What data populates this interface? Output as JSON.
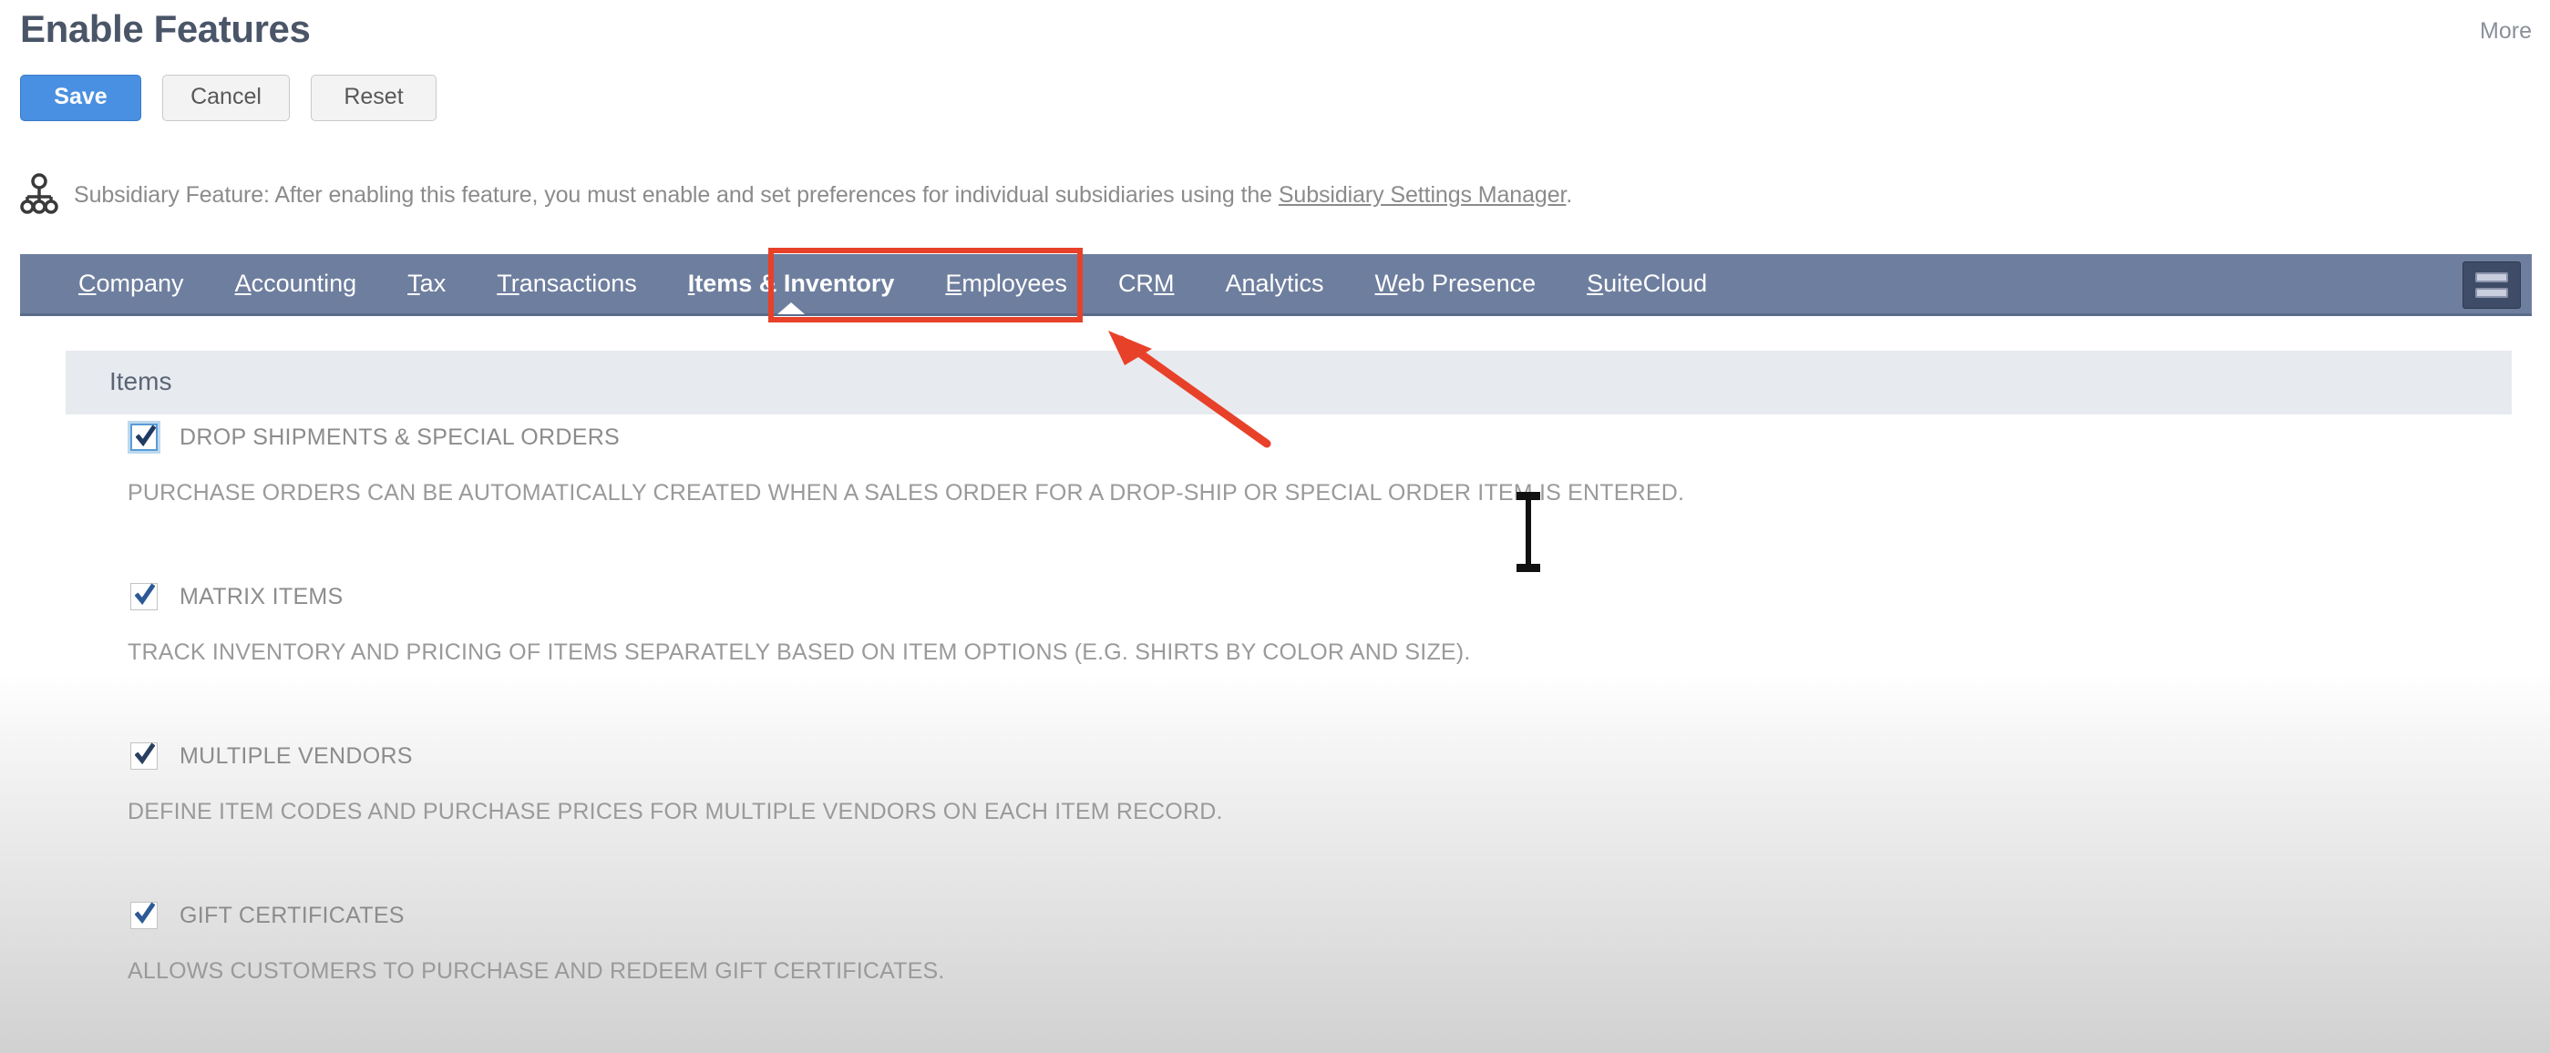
{
  "header": {
    "title": "Enable Features",
    "more_label": "More"
  },
  "toolbar": {
    "save_label": "Save",
    "cancel_label": "Cancel",
    "reset_label": "Reset"
  },
  "notice": {
    "icon": "hierarchy-icon",
    "text_before": "Subsidiary Feature: After enabling this feature, you must enable and set preferences for individual subsidiaries using the ",
    "link_label": "Subsidiary Settings Manager",
    "text_after": "."
  },
  "tabs": {
    "active": "Items & Inventory",
    "items": [
      {
        "label": "Company",
        "accel": "C",
        "rest": "ompany",
        "active": false
      },
      {
        "label": "Accounting",
        "accel": "A",
        "rest": "ccounting",
        "active": false
      },
      {
        "label": "Tax",
        "accel": "T",
        "rest": "ax",
        "active": false
      },
      {
        "label": "Transactions",
        "accel": "Tr",
        "rest": "ansactions",
        "active": false
      },
      {
        "label": "Items & Inventory",
        "accel": "I",
        "rest": "tems & Inventory",
        "active": true
      },
      {
        "label": "Employees",
        "accel": "E",
        "rest": "mployees",
        "active": false
      },
      {
        "label": "CRM",
        "accel": "CRM",
        "rest": "",
        "active": false
      },
      {
        "label": "Analytics",
        "accel": "An",
        "rest": "alytics",
        "active": false
      },
      {
        "label": "Web Presence",
        "accel": "W",
        "rest": "eb Presence",
        "active": false
      },
      {
        "label": "SuiteCloud",
        "accel": "S",
        "rest": "uiteCloud",
        "active": false
      }
    ],
    "layout_toggle_icon": "list-layout-icon"
  },
  "section": {
    "title": "Items"
  },
  "features": [
    {
      "label": "DROP SHIPMENTS & SPECIAL ORDERS",
      "description": "PURCHASE ORDERS CAN BE AUTOMATICALLY CREATED WHEN A SALES ORDER FOR A DROP-SHIP OR SPECIAL ORDER ITEM IS ENTERED.",
      "checked": true,
      "focused": true
    },
    {
      "label": "MATRIX ITEMS",
      "description": "TRACK INVENTORY AND PRICING OF ITEMS SEPARATELY BASED ON ITEM OPTIONS (E.G. SHIRTS BY COLOR AND SIZE).",
      "checked": true,
      "focused": false
    },
    {
      "label": "MULTIPLE VENDORS",
      "description": "DEFINE ITEM CODES AND PURCHASE PRICES FOR MULTIPLE VENDORS ON EACH ITEM RECORD.",
      "checked": true,
      "focused": false
    },
    {
      "label": "GIFT CERTIFICATES",
      "description": "ALLOWS CUSTOMERS TO PURCHASE AND REDEEM GIFT CERTIFICATES.",
      "checked": true,
      "focused": false
    }
  ],
  "annotations": {
    "highlight_color": "#e8412a",
    "arrow_color": "#e8412a",
    "arrow_target": "Items & Inventory",
    "cursor": "text-ibeam-cursor"
  },
  "colors": {
    "primary_button": "#4a90e2",
    "tabbar": "#6e7e9e",
    "section_header": "#e7eaef",
    "title_text": "#4a5568"
  }
}
